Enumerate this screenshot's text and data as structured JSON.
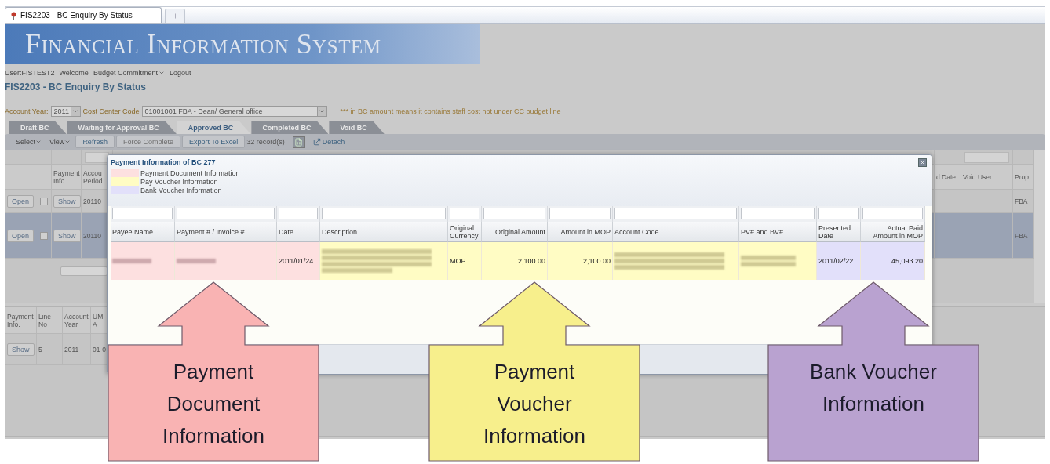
{
  "browser_tab": {
    "title": "FIS2203 - BC Enquiry By Status"
  },
  "banner": {
    "title": "Financial Information System"
  },
  "user_bar": {
    "user": "User:FISTEST2",
    "links": [
      {
        "label": "Welcome",
        "dropdown": false
      },
      {
        "label": "Budget Commitment",
        "dropdown": true
      },
      {
        "label": "Logout",
        "dropdown": false
      }
    ]
  },
  "page_title": "FIS2203 - BC Enquiry By Status",
  "filters": {
    "account_year_label": "Account Year:",
    "account_year": "2011",
    "cost_center_label": "Cost Center Code",
    "cost_center": "01001001 FBA - Dean/ General office",
    "note": "*** in BC amount means it contains staff cost not under CC budget line"
  },
  "tabs": [
    {
      "label": "Draft BC",
      "selected": false
    },
    {
      "label": "Waiting for Approval BC",
      "selected": false
    },
    {
      "label": "Approved BC",
      "selected": true
    },
    {
      "label": "Completed BC",
      "selected": false
    },
    {
      "label": "Void BC",
      "selected": false
    }
  ],
  "toolbar": [
    {
      "kind": "menu",
      "label": "Select"
    },
    {
      "kind": "menu",
      "label": "View"
    },
    {
      "kind": "button",
      "label": "Refresh",
      "disabled": false
    },
    {
      "kind": "button",
      "label": "Force Complete",
      "disabled": true
    },
    {
      "kind": "button",
      "label": "Export To Excel",
      "disabled": false
    },
    {
      "kind": "count",
      "label": "32 record(s)"
    },
    {
      "kind": "icon_button"
    },
    {
      "kind": "icon_link",
      "label": "Detach"
    }
  ],
  "main_grid": {
    "left_columns": [
      "Payment Info.",
      "Accou Period"
    ],
    "right_columns": [
      "d Date",
      "Void User",
      "Prop"
    ],
    "rows": [
      {
        "selected": false,
        "checked": false,
        "open": "Open",
        "show": "Show",
        "period": "20110",
        "prop": "FBA"
      },
      {
        "selected": true,
        "checked": false,
        "open": "Open",
        "show": "Show",
        "period": "20110",
        "prop": "FBA"
      }
    ]
  },
  "lower_grid": {
    "columns": [
      "Payment Info.",
      "Line No",
      "Account Year",
      "UM A"
    ],
    "rows": [
      {
        "show": "Show",
        "line_no": "5",
        "account_year": "2011",
        "um": "01-0"
      }
    ]
  },
  "modal": {
    "title": "Payment Information of BC 277",
    "legend": [
      {
        "label": "Payment Document Information",
        "color": "#fde0e0"
      },
      {
        "label": "Pay Voucher Information",
        "color": "#fffcc4"
      },
      {
        "label": "Bank Voucher Information",
        "color": "#e2e0fa"
      }
    ],
    "columns": [
      {
        "label": "Payee Name",
        "kind": "text",
        "color": "#fde0e0"
      },
      {
        "label": "Payment # / Invoice #",
        "kind": "text",
        "color": "#fde0e0"
      },
      {
        "label": "Date",
        "kind": "text",
        "color": "#fde0e0"
      },
      {
        "label": "Description",
        "kind": "text",
        "color": "#fffcc4"
      },
      {
        "label": "Original Currency",
        "kind": "text",
        "color": "#fffcc4"
      },
      {
        "label": "Original Amount",
        "kind": "amount",
        "color": "#fffcc4"
      },
      {
        "label": "Amount in MOP",
        "kind": "amount",
        "color": "#fffcc4"
      },
      {
        "label": "Account Code",
        "kind": "text",
        "color": "#fffcc4"
      },
      {
        "label": "PV# and BV#",
        "kind": "text",
        "color": "#fffcc4"
      },
      {
        "label": "Presented Date",
        "kind": "text",
        "color": "#e2e0fa"
      },
      {
        "label": "Actual Paid Amount in MOP",
        "kind": "amount",
        "color": "#e2e0fa"
      }
    ],
    "rows": [
      {
        "cells": [
          {
            "kind": "redacted"
          },
          {
            "kind": "redacted"
          },
          {
            "kind": "text",
            "text": "2011/01/24"
          },
          {
            "kind": "redacted_block"
          },
          {
            "kind": "text",
            "text": "MOP"
          },
          {
            "kind": "text",
            "text": "2,100.00"
          },
          {
            "kind": "text",
            "text": "2,100.00"
          },
          {
            "kind": "redacted_block"
          },
          {
            "kind": "redacted_block"
          },
          {
            "kind": "text",
            "text": "2011/02/22"
          },
          {
            "kind": "text",
            "text": "45,093.20"
          }
        ]
      }
    ]
  },
  "callouts": [
    {
      "label": "Payment Document Information",
      "color": "#f9b3b3"
    },
    {
      "label": "Payment Voucher Information",
      "color": "#f7ef8c"
    },
    {
      "label": "Bank Voucher Information",
      "color": "#b9a2d0"
    }
  ]
}
